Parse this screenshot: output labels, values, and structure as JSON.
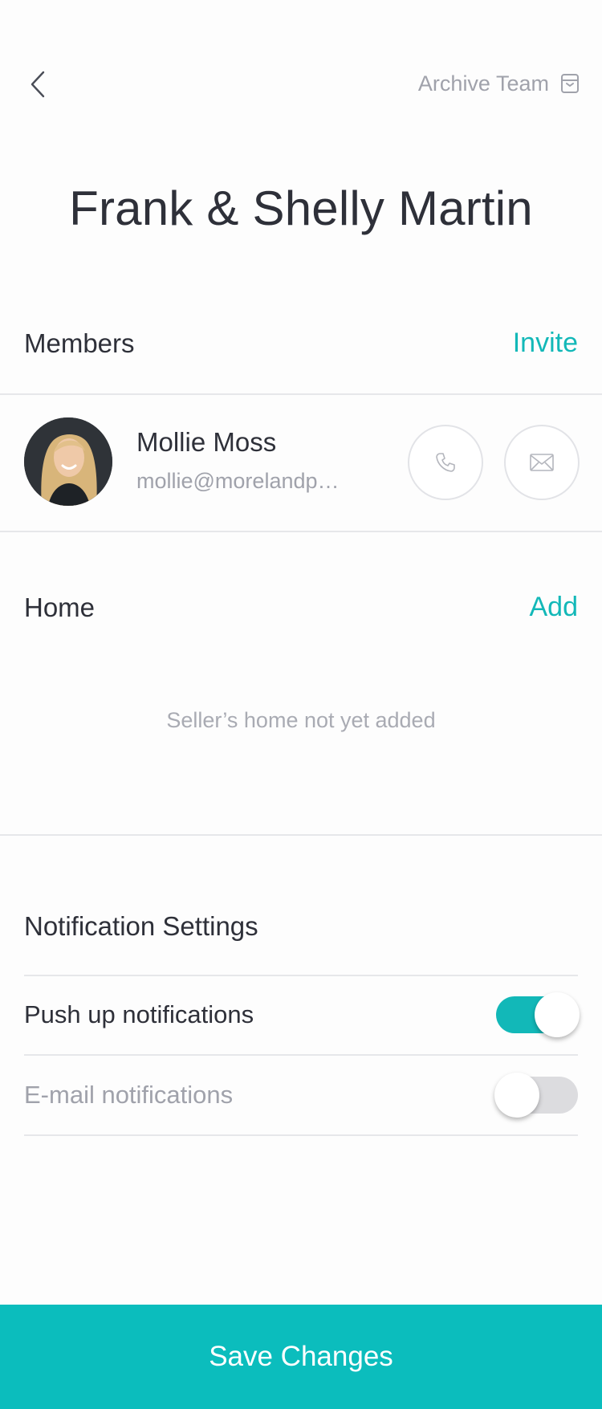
{
  "header": {
    "back_icon": "chevron-left-icon",
    "archive_label": "Archive Team",
    "archive_icon": "archive-box-icon"
  },
  "team": {
    "title": "Frank & Shelly Martin"
  },
  "members": {
    "label": "Members",
    "action": "Invite",
    "items": [
      {
        "name": "Mollie Moss",
        "email": "mollie@morelandp…",
        "call_icon": "phone-icon",
        "mail_icon": "mail-icon"
      }
    ]
  },
  "home": {
    "label": "Home",
    "action": "Add",
    "empty_text": "Seller’s home not yet added"
  },
  "notifications": {
    "label": "Notification Settings",
    "items": [
      {
        "label": "Push up notifications",
        "enabled": true
      },
      {
        "label": "E-mail notifications",
        "enabled": false
      }
    ]
  },
  "footer": {
    "save_label": "Save Changes"
  },
  "colors": {
    "accent": "#12B8B8",
    "save_bar": "#0BBDBD",
    "text": "#2E3039",
    "muted": "#A0A2AB"
  }
}
